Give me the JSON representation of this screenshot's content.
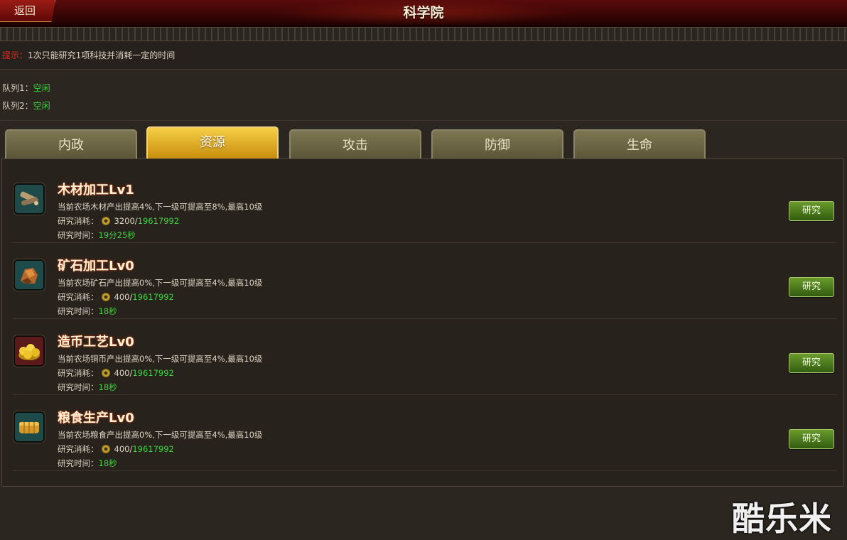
{
  "header": {
    "back_label": "返回",
    "title": "科学院"
  },
  "tip": {
    "label": "提示：",
    "text": "1次只能研究1项科技并消耗一定的时间"
  },
  "queues": [
    {
      "label": "队列1：",
      "status": "空闲"
    },
    {
      "label": "队列2：",
      "status": "空闲"
    }
  ],
  "tabs": [
    {
      "label": "内政",
      "active": false
    },
    {
      "label": "资源",
      "active": true
    },
    {
      "label": "攻击",
      "active": false
    },
    {
      "label": "防御",
      "active": false
    },
    {
      "label": "生命",
      "active": false
    }
  ],
  "items": [
    {
      "title": "木材加工Lv1",
      "desc": "当前农场木材产出提高4%,下一级可提高至8%,最高10级",
      "cost_label": "研究消耗：",
      "cost_need": "3200",
      "cost_sep": "/",
      "cost_have": "19617992",
      "time_label": "研究时间：",
      "time_value": "19分25秒",
      "button_label": "研究",
      "icon": "wood-icon"
    },
    {
      "title": "矿石加工Lv0",
      "desc": "当前农场矿石产出提高0%,下一级可提高至4%,最高10级",
      "cost_label": "研究消耗：",
      "cost_need": "400",
      "cost_sep": "/",
      "cost_have": "19617992",
      "time_label": "研究时间：",
      "time_value": "18秒",
      "button_label": "研究",
      "icon": "ore-icon"
    },
    {
      "title": "造币工艺Lv0",
      "desc": "当前农场铜币产出提高0%,下一级可提高至4%,最高10级",
      "cost_label": "研究消耗：",
      "cost_need": "400",
      "cost_sep": "/",
      "cost_have": "19617992",
      "time_label": "研究时间：",
      "time_value": "18秒",
      "button_label": "研究",
      "icon": "coins-icon"
    },
    {
      "title": "粮食生产Lv0",
      "desc": "当前农场粮食产出提高0%,下一级可提高至4%,最高10级",
      "cost_label": "研究消耗：",
      "cost_need": "400",
      "cost_sep": "/",
      "cost_have": "19617992",
      "time_label": "研究时间：",
      "time_value": "18秒",
      "button_label": "研究",
      "icon": "grain-icon"
    }
  ],
  "watermark": "酷乐米",
  "colors": {
    "accent_green": "#3fd43f",
    "tip_red": "#e22a1f",
    "tab_active": "#f7cf46"
  }
}
